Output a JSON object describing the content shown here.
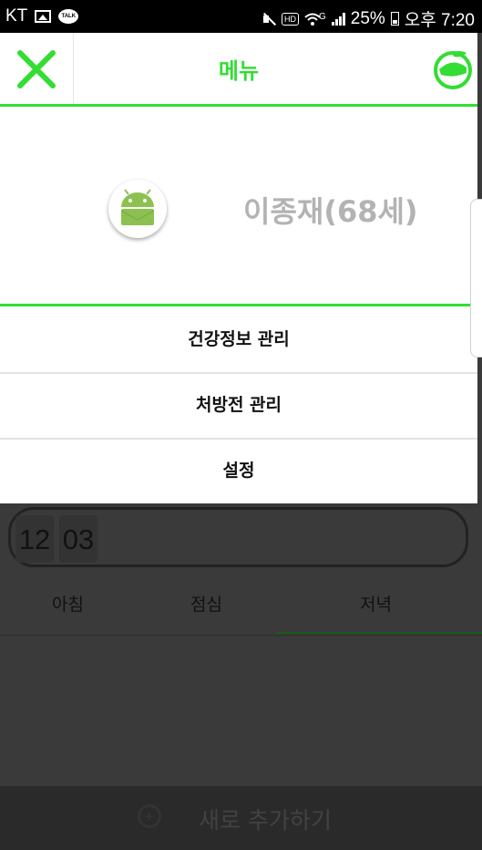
{
  "status_bar": {
    "carrier": "KT",
    "network": "G",
    "battery": "25%",
    "time": "오후 7:20",
    "talk_badge": "TALK",
    "hd_badge": "HD"
  },
  "menu": {
    "title": "메뉴",
    "user_name": "이종재(68세)",
    "items": [
      {
        "label": "건강정보 관리"
      },
      {
        "label": "처방전 관리"
      },
      {
        "label": "설정"
      }
    ]
  },
  "background": {
    "time_hour": "12",
    "time_minute": "03",
    "tabs": [
      {
        "label": "아침"
      },
      {
        "label": "점심"
      },
      {
        "label": "저녁",
        "selected": true
      }
    ],
    "add_label": "새로 추가하기"
  },
  "colors": {
    "accent": "#2ee02e",
    "name_gray": "#b3b3b3",
    "dim_overlay": "#3a3a3a"
  }
}
